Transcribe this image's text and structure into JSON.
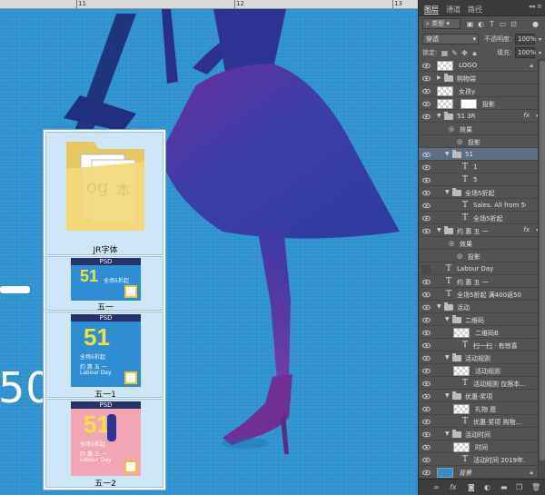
{
  "ruler": {
    "labels": [
      "11",
      "12",
      "13"
    ]
  },
  "canvas": {
    "big_number": "50"
  },
  "file_list": {
    "items": [
      {
        "label": "JR字体",
        "kind": "folder",
        "folder_glyphs": [
          "og",
          "本"
        ]
      },
      {
        "label": "五一",
        "kind": "psd",
        "head": "PSD",
        "big": "51",
        "sub": "全场5折起",
        "accent": "#f3e23a"
      },
      {
        "label": "五一1",
        "kind": "psd",
        "head": "PSD",
        "big": "51",
        "sub": "全场5折起",
        "mid": "约 惠 五 一",
        "tag": "Labour Day",
        "accent": "#f3e23a"
      },
      {
        "label": "五一2",
        "kind": "psd",
        "head": "PSD",
        "big": "51",
        "sub": "全场5折起",
        "mid": "约 惠 五 一",
        "tag": "Labour Day",
        "accent": "#f3e23a"
      }
    ]
  },
  "layers_panel": {
    "tabs": [
      "图层",
      "通道",
      "路径"
    ],
    "active_tab": "图层",
    "filter_label": "类型",
    "blend_mode": "穿透",
    "opacity_label": "不透明度:",
    "opacity_value": "100%",
    "lock_label": "锁定:",
    "fill_label": "填充:",
    "fill_value": "100%",
    "layers": [
      {
        "name": "LOGO",
        "indent": 0,
        "kind": "thumb",
        "lock": true
      },
      {
        "name": "购物袋",
        "indent": 0,
        "kind": "folder",
        "collapsed": true
      },
      {
        "name": "女孩y",
        "indent": 0,
        "kind": "thumb-mask"
      },
      {
        "name": "投影",
        "indent": 0,
        "kind": "thumb-mask2"
      },
      {
        "name": "51 3R",
        "indent": 0,
        "kind": "folder",
        "fx": true
      },
      {
        "name": "效果",
        "indent": 1,
        "kind": "effect",
        "noeye": true
      },
      {
        "name": "投影",
        "indent": 2,
        "kind": "effect",
        "noeye": true
      },
      {
        "name": "51",
        "indent": 1,
        "kind": "folder",
        "selected": true
      },
      {
        "name": "1",
        "indent": 2,
        "kind": "text"
      },
      {
        "name": "5",
        "indent": 2,
        "kind": "text"
      },
      {
        "name": "全场5折起",
        "indent": 1,
        "kind": "folder"
      },
      {
        "name": "Sales. All from 50...",
        "indent": 2,
        "kind": "text"
      },
      {
        "name": "全场5折起",
        "indent": 2,
        "kind": "text"
      },
      {
        "name": "约 惠 五 一",
        "indent": 0,
        "kind": "folder",
        "fx": true
      },
      {
        "name": "效果",
        "indent": 1,
        "kind": "effect",
        "noeye": true
      },
      {
        "name": "投影",
        "indent": 2,
        "kind": "effect",
        "noeye": true
      },
      {
        "name": "Labour Day",
        "indent": 0,
        "kind": "text",
        "hidden": true
      },
      {
        "name": "约 惠 五 一",
        "indent": 0,
        "kind": "text"
      },
      {
        "name": "全场5折起 满400返50",
        "indent": 0,
        "kind": "text"
      },
      {
        "name": "活动",
        "indent": 0,
        "kind": "folder"
      },
      {
        "name": "二维码",
        "indent": 1,
        "kind": "folder"
      },
      {
        "name": "二维码B",
        "indent": 2,
        "kind": "thumb"
      },
      {
        "name": "扫一扫 · 有惊喜",
        "indent": 2,
        "kind": "text"
      },
      {
        "name": "活动规则",
        "indent": 1,
        "kind": "folder"
      },
      {
        "name": "活动规则",
        "indent": 2,
        "kind": "thumb"
      },
      {
        "name": "活动规则 仅限本...",
        "indent": 2,
        "kind": "text"
      },
      {
        "name": "优惠·奖项",
        "indent": 1,
        "kind": "folder"
      },
      {
        "name": "礼物 愿",
        "indent": 2,
        "kind": "thumb"
      },
      {
        "name": "优惠·奖项 购物...",
        "indent": 2,
        "kind": "text"
      },
      {
        "name": "活动时间",
        "indent": 1,
        "kind": "folder"
      },
      {
        "name": "时间",
        "indent": 2,
        "kind": "thumb"
      },
      {
        "name": "活动时间 2019年...",
        "indent": 2,
        "kind": "text"
      },
      {
        "name": "背景",
        "indent": 0,
        "kind": "bg",
        "lock": true,
        "color": "#2d8fd0"
      }
    ]
  }
}
